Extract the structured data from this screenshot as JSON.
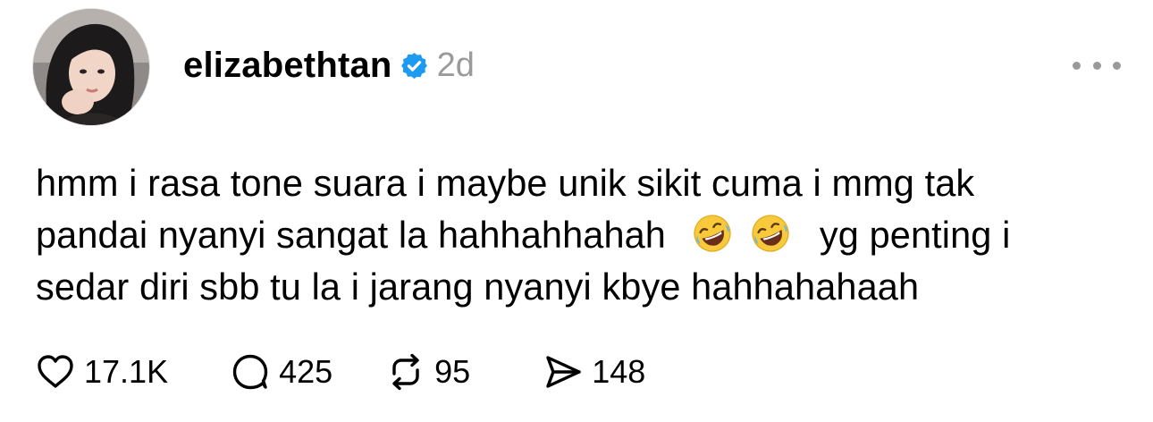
{
  "post": {
    "username": "elizabethtan",
    "timestamp": "2d",
    "text_lines": [
      "hmm i rasa tone suara i maybe unik sikit cuma i mmg tak",
      "pandai nyanyi sangat la hahhahhahah",
      "yg penting i",
      "sedar diri sbb tu la i jarang nyanyi kbye hahhahahaah"
    ],
    "emojis": [
      "rolling-on-floor-laughing",
      "rolling-on-floor-laughing"
    ]
  },
  "actions": {
    "likes": "17.1K",
    "replies": "425",
    "reposts": "95",
    "shares": "148"
  },
  "colors": {
    "verified": "#1d9bf0",
    "muted": "#9a9a9a",
    "text": "#000000"
  },
  "icons": {
    "verified": "verified-badge-icon",
    "more": "more-dots-icon",
    "like": "heart-icon",
    "reply": "comment-bubble-icon",
    "repost": "repost-arrows-icon",
    "share": "send-paper-plane-icon"
  }
}
